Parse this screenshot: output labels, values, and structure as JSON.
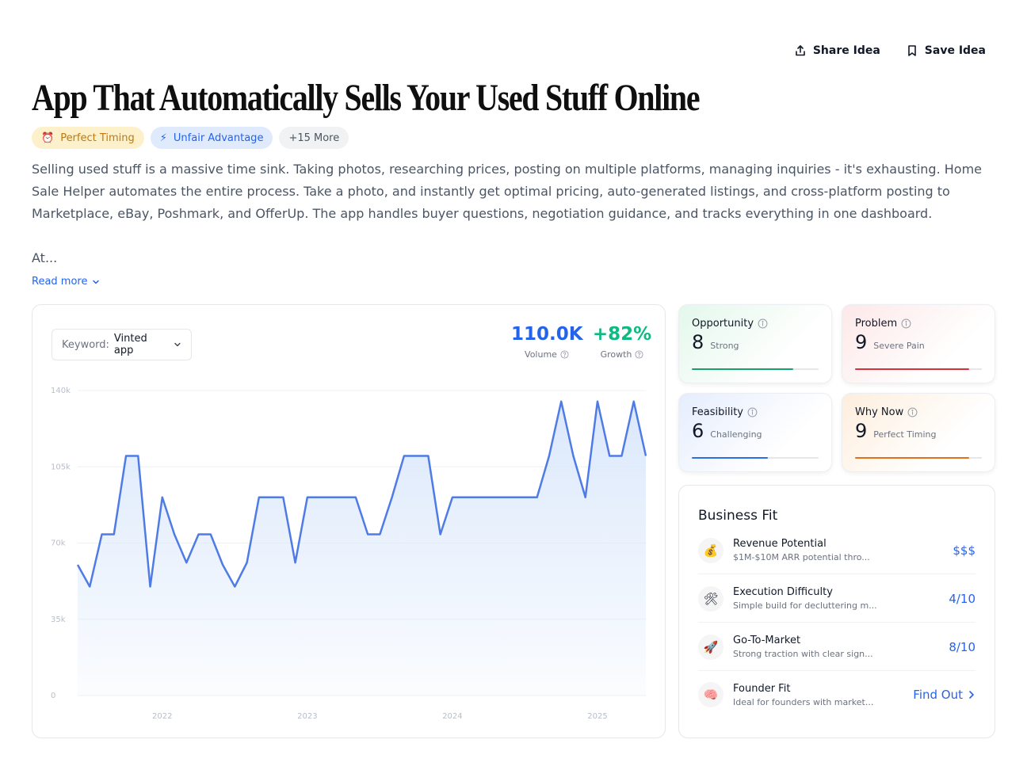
{
  "header": {
    "share_label": "Share Idea",
    "save_label": "Save Idea",
    "title": "App That Automatically Sells Your Used Stuff Online"
  },
  "tags": [
    {
      "icon": "alarm-clock-icon",
      "glyph": "⏰",
      "label": "Perfect Timing"
    },
    {
      "icon": "lightning-icon",
      "glyph": "⚡",
      "label": "Unfair Advantage"
    },
    {
      "label": "+15 More"
    }
  ],
  "description": {
    "text": "Selling used stuff is a massive time sink. Taking photos, researching prices, posting on multiple platforms, managing inquiries - it's exhausting. Home Sale Helper automates the entire process. Take a photo, and instantly get optimal pricing, auto-generated listings, and cross-platform posting to Marketplace, eBay, Poshmark, and OfferUp. The app handles buyer questions, negotiation guidance, and tracks everything in one dashboard.",
    "truncated": "At...",
    "read_more": "Read more"
  },
  "trend": {
    "keyword_label": "Keyword:",
    "keyword_value": "Vinted app",
    "volume_value": "110.0K",
    "volume_label": "Volume",
    "growth_value": "+82%",
    "growth_label": "Growth"
  },
  "chart_data": {
    "type": "area",
    "title": "",
    "ylim": [
      0,
      140000
    ],
    "y_ticks": [
      0,
      35000,
      70000,
      105000,
      140000
    ],
    "y_tick_labels": [
      "0",
      "35k",
      "70k",
      "105k",
      "140k"
    ],
    "x_tick_labels": [
      "2022",
      "2023",
      "2024",
      "2025"
    ],
    "x_tick_positions": [
      7,
      19,
      31,
      43
    ],
    "series": [
      {
        "values": [
          60000,
          50000,
          74000,
          74000,
          110000,
          110000,
          50000,
          91000,
          74000,
          61000,
          74000,
          74000,
          60000,
          50000,
          61000,
          91000,
          91000,
          91000,
          61000,
          91000,
          91000,
          91000,
          91000,
          91000,
          74000,
          74000,
          91000,
          110000,
          110000,
          110000,
          74000,
          91000,
          91000,
          91000,
          91000,
          91000,
          91000,
          91000,
          91000,
          110000,
          135000,
          110000,
          91000,
          135000,
          110000,
          110000,
          135000,
          110000
        ]
      }
    ],
    "line_color": "#4f7be6",
    "fill_color": "#dbe8fb",
    "grid": true
  },
  "scores": {
    "opportunity": {
      "label": "Opportunity",
      "score": "8",
      "desc": "Strong",
      "fraction": 0.8,
      "color": "#16a36b"
    },
    "problem": {
      "label": "Problem",
      "score": "9",
      "desc": "Severe Pain",
      "fraction": 0.9,
      "color": "#dc2f3c"
    },
    "feasibility": {
      "label": "Feasibility",
      "score": "6",
      "desc": "Challenging",
      "fraction": 0.6,
      "color": "#2d6fe0"
    },
    "why_now": {
      "label": "Why Now",
      "score": "9",
      "desc": "Perfect Timing",
      "fraction": 0.9,
      "color": "#e5701b"
    }
  },
  "business_fit": {
    "title": "Business Fit",
    "items": [
      {
        "icon": "money-bag-icon",
        "glyph": "💰",
        "title": "Revenue Potential",
        "subtitle": "$1M-$10M ARR potential thro...",
        "value": "$$$"
      },
      {
        "icon": "tools-icon",
        "glyph": "🛠",
        "title": "Execution Difficulty",
        "subtitle": "Simple build for decluttering m...",
        "value": "4/10"
      },
      {
        "icon": "rocket-icon",
        "glyph": "🚀",
        "title": "Go-To-Market",
        "subtitle": "Strong traction with clear sign...",
        "value": "8/10"
      },
      {
        "icon": "brain-icon",
        "glyph": "🧠",
        "title": "Founder Fit",
        "subtitle": "Ideal for founders with market...",
        "value": "Find Out"
      }
    ]
  }
}
